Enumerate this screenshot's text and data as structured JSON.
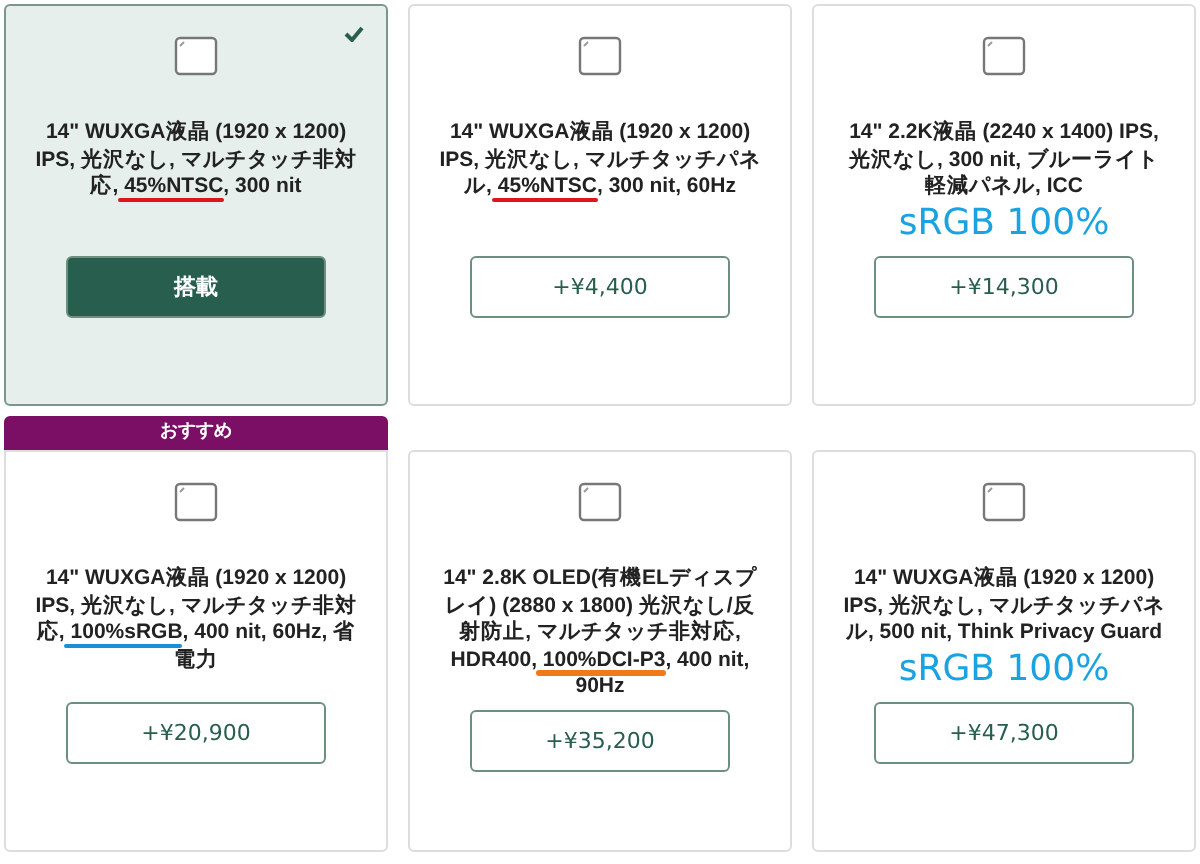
{
  "cards": [
    {
      "selected": true,
      "description": {
        "before": "14\" WUXGA液晶 (1920 x 1200) IPS, 光沢なし, マルチタッチ非対応, ",
        "marked": "45%NTSC",
        "after": ", 300 nit",
        "color": "#e0141e"
      },
      "button": "搭載"
    },
    {
      "selected": false,
      "description": {
        "before": "14\" WUXGA液晶 (1920 x 1200) IPS, 光沢なし, マルチタッチパネル, ",
        "marked": "45%NTSC",
        "after": ", 300 nit, 60Hz",
        "color": "#e0141e"
      },
      "button": "+¥4,400"
    },
    {
      "selected": false,
      "description": {
        "before": "14\" 2.2K液晶 (2240 x 1400) IPS, 光沢なし, 300 nit, ブルーライト軽減パネル, ICC"
      },
      "note": "sRGB 100%",
      "button": "+¥14,300"
    },
    {
      "selected": false,
      "badge": "おすすめ",
      "description": {
        "before": "14\" WUXGA液晶 (1920 x 1200) IPS, 光沢なし, マルチタッチ非対応, ",
        "marked": "100%sRGB",
        "after": ", 400 nit, 60Hz, 省電力",
        "color": "#1a8fd8"
      },
      "button": "+¥20,900"
    },
    {
      "selected": false,
      "description": {
        "before": "14\" 2.8K OLED(有機ELディスプレイ) (2880 x 1800) 光沢なし/反射防止, マルチタッチ非対応, HDR400, ",
        "marked": "100%DCI-P3",
        "after": ", 400 nit, 90Hz",
        "color": "#f07a1a"
      },
      "button": "+¥35,200"
    },
    {
      "selected": false,
      "description": {
        "before": "14\" WUXGA液晶 (1920 x 1200) IPS, 光沢なし, マルチタッチパネル, 500 nit, Think Privacy Guard"
      },
      "note": "sRGB 100%",
      "button": "+¥47,300"
    }
  ]
}
